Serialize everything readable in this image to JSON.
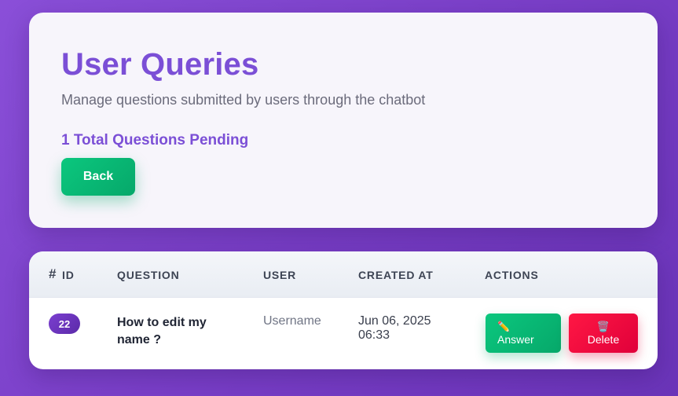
{
  "header": {
    "title": "User Queries",
    "subtitle": "Manage questions submitted by users through the chatbot",
    "pending": "1 Total Questions Pending",
    "back_label": "Back"
  },
  "table": {
    "columns": {
      "id_hash": "#",
      "id": "ID",
      "question": "QUESTION",
      "user": "USER",
      "created_at": "CREATED AT",
      "actions": "ACTIONS"
    },
    "rows": [
      {
        "id": "22",
        "question": "How to edit my name ?",
        "user": "Username",
        "created_at": "Jun 06, 2025 06:33",
        "answer_icon": "✏️",
        "answer_label": "Answer",
        "delete_icon": "🗑️",
        "delete_label": "Delete"
      }
    ]
  },
  "colors": {
    "accent": "#7b4fd6",
    "success": "#0bc77e",
    "danger": "#ff1744",
    "background": "#8a4fd8"
  },
  "icons": {
    "answer": "pencil-icon",
    "delete": "trash-icon"
  }
}
